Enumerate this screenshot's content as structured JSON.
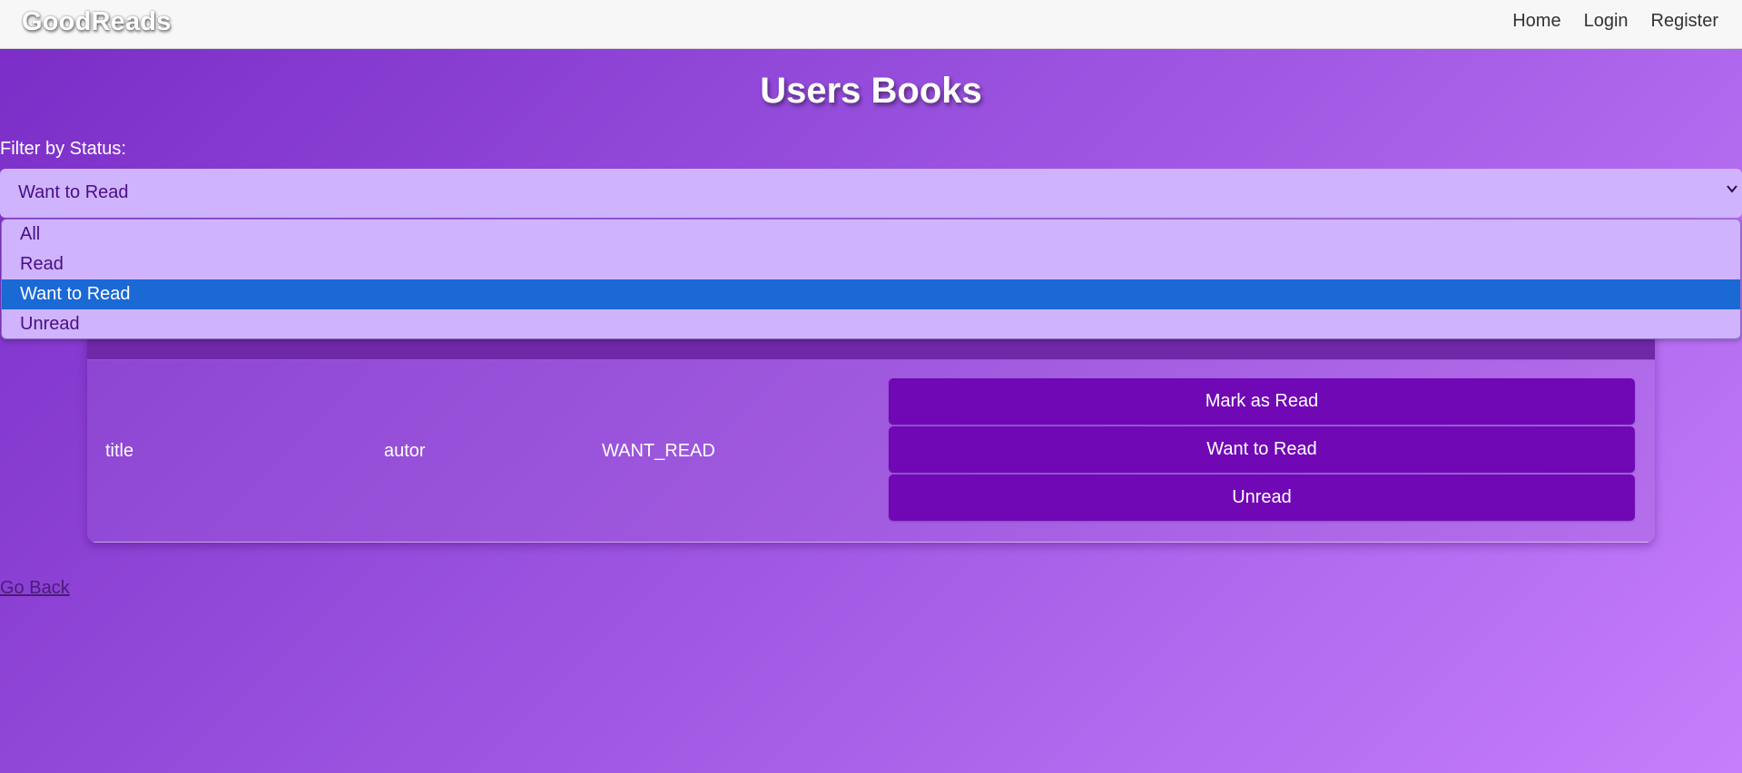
{
  "nav": {
    "brand": "GoodReads",
    "links": [
      "Home",
      "Login",
      "Register"
    ]
  },
  "page": {
    "title": "Users Books"
  },
  "filter": {
    "label": "Filter by Status:",
    "selected": "Want to Read",
    "options": [
      "All",
      "Read",
      "Want to Read",
      "Unread"
    ]
  },
  "table": {
    "rows": [
      {
        "title": "title",
        "author": "autor",
        "status": "WANT_READ",
        "actions": [
          "Mark as Read",
          "Want to Read",
          "Unread"
        ]
      }
    ]
  },
  "footer": {
    "go_back": "Go Back"
  },
  "icons": {
    "select_arrow": "chevron-down-icon"
  },
  "colors": {
    "button": "#7008b5",
    "select_background": "#cfb4fd",
    "option_highlight": "#1a69d4",
    "table_header": "#6f28a8"
  }
}
